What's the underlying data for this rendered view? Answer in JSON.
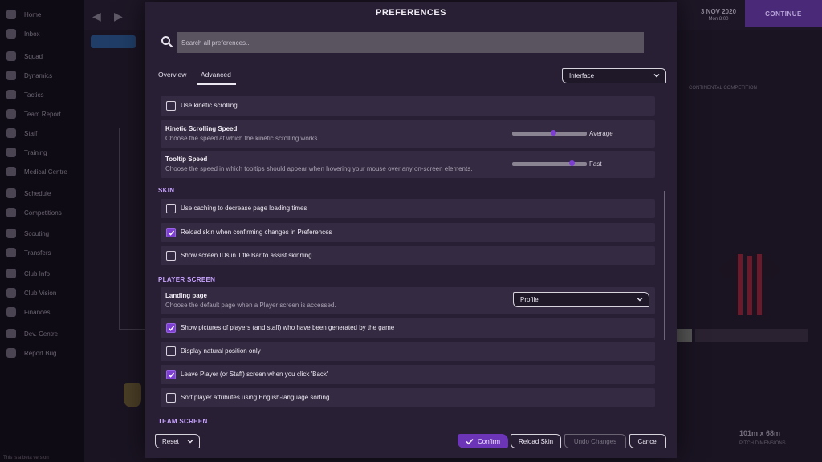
{
  "background": {
    "sidebar_items": [
      "Home",
      "Inbox",
      "Squad",
      "Dynamics",
      "Tactics",
      "Team Report",
      "Staff",
      "Training",
      "Medical Centre",
      "Schedule",
      "Competitions",
      "Scouting",
      "Transfers",
      "Club Info",
      "Club Vision",
      "Finances",
      "Dev. Centre",
      "Report Bug"
    ],
    "date": "3 NOV 2020",
    "time": "Mon 8:00",
    "continue_label": "CONTINUE",
    "competition_label": "CONTINENTAL COMPETITION",
    "stadium_size": "101m x 68m",
    "stadium_caption": "PITCH DIMENSIONS",
    "status": "This is a beta version"
  },
  "modal": {
    "title": "PREFERENCES",
    "search": {
      "placeholder": "Search all preferences..."
    },
    "tabs": [
      "Overview",
      "Advanced"
    ],
    "category_dropdown": "Interface",
    "rows": {
      "kinetic_scrolling": "Use kinetic scrolling",
      "kinetic_speed": {
        "title": "Kinetic Scrolling Speed",
        "desc": "Choose the speed at which the kinetic scrolling works.",
        "value": "Average",
        "level": 0.55
      },
      "tooltip_speed": {
        "title": "Tooltip Speed",
        "desc": "Choose the speed in which tooltips should appear when hovering your mouse over any on-screen elements.",
        "value": "Fast",
        "level": 0.8
      }
    },
    "sections": {
      "skin": {
        "heading": "SKIN",
        "caching": "Use caching to decrease page loading times",
        "reload_skin": "Reload skin when confirming changes in Preferences",
        "screen_ids": "Show screen IDs in Title Bar to assist skinning"
      },
      "player_screen": {
        "heading": "PLAYER SCREEN",
        "landing_title": "Landing page",
        "landing_desc": "Choose the default page when a Player screen is accessed.",
        "landing_value": "Profile",
        "show_pictures": "Show pictures of players (and staff) who have been generated by the game",
        "natural_position": "Display natural position only",
        "leave_back": "Leave Player (or Staff) screen when you click 'Back'",
        "sort_attributes": "Sort player attributes using English-language sorting"
      },
      "team_screen": {
        "heading": "TEAM SCREEN"
      }
    },
    "footer": {
      "reset": "Reset",
      "confirm": "Confirm",
      "reload_skin": "Reload Skin",
      "undo": "Undo Changes",
      "cancel": "Cancel"
    },
    "colors": {
      "accent": "#7d3fd2",
      "panel": "#281f35",
      "row": "#342a41",
      "section": "#c8a3ff"
    }
  }
}
